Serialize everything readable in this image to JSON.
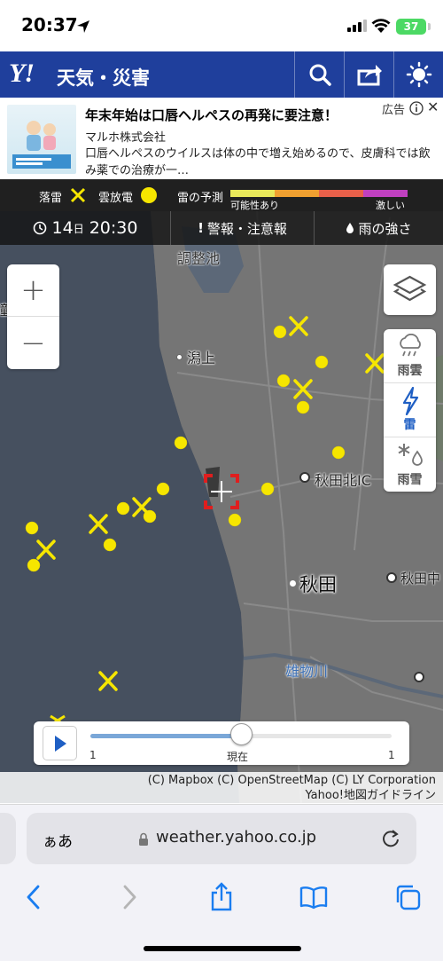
{
  "status": {
    "time": "20:37",
    "battery": "37"
  },
  "header": {
    "logo": "Y!",
    "title": "天気・災害"
  },
  "ad": {
    "title": "年末年始は口唇ヘルペスの再発に要注意！",
    "sponsor": "マルホ株式会社",
    "body": "口唇ヘルペスのウイルスは体の中で増え始めるので、皮膚科では飲み薬での治療が一…",
    "label": "広告"
  },
  "legend": {
    "strike": "落雷",
    "cloud": "雲放電",
    "forecast": "雷の予測",
    "possible": "可能性あり",
    "intense": "激しい",
    "scale_colors": [
      "#e8e85a",
      "#f0a030",
      "#e8604a",
      "#c040c0"
    ]
  },
  "toolbar": {
    "day_num": "14",
    "day_unit": "日",
    "time": "20:30",
    "warnings": "警報・注意報",
    "rain": "雨の強さ"
  },
  "map": {
    "places": {
      "pond": "調整池",
      "kata": "潟上",
      "akitakita": "秋田北IC",
      "akita": "秋田",
      "omono": "雄物川",
      "akitanaka": "秋田中"
    },
    "cut_label": "鐘"
  },
  "zoom": {
    "in": "+",
    "out": "−"
  },
  "modes": {
    "rain_cloud": "雨雲",
    "thunder": "雷",
    "sleet": "雨雪"
  },
  "slider": {
    "left": "1",
    "mid": "現在",
    "right": "1",
    "progress": 0.5
  },
  "copyright": {
    "line1": "(C) Mapbox (C) OpenStreetMap (C) LY Corporation",
    "line2": "Yahoo!地図ガイドライン"
  },
  "browser": {
    "aa": "ぁあ",
    "url": "weather.yahoo.co.jp"
  },
  "colors": {
    "header": "#1f3f9c",
    "lightning": "#f6e600",
    "active": "#1f5fc4"
  }
}
